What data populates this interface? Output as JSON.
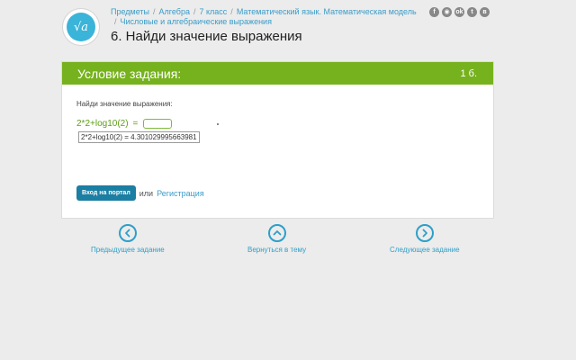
{
  "logo": {
    "symbol": "√a"
  },
  "breadcrumb": {
    "items": [
      "Предметы",
      "Алгебра",
      "7 класс",
      "Математический язык. Математическая модель",
      "Числовые и алгебраические выражения"
    ]
  },
  "page": {
    "title": "6. Найди значение выражения"
  },
  "social": {
    "icons": [
      "f",
      "◉",
      "ok",
      "t",
      "в"
    ]
  },
  "task": {
    "header_title": "Условие задания:",
    "points": "1 б.",
    "instruction": "Найди значение выражения:",
    "expression": "2*2+log10(2)",
    "equals": "=",
    "answer_value": "",
    "tooltip": "2*2+log10(2) = 4.301029995663981"
  },
  "auth": {
    "login_label": "Вход на портал",
    "or_text": "или",
    "register_label": "Регистрация"
  },
  "nav": {
    "prev_label": "Предыдущее задание",
    "back_label": "Вернуться в тему",
    "next_label": "Следующее задание"
  },
  "colors": {
    "accent_green": "#76b21d",
    "link_blue": "#3a9cc8",
    "button_blue": "#1b7ea3"
  }
}
